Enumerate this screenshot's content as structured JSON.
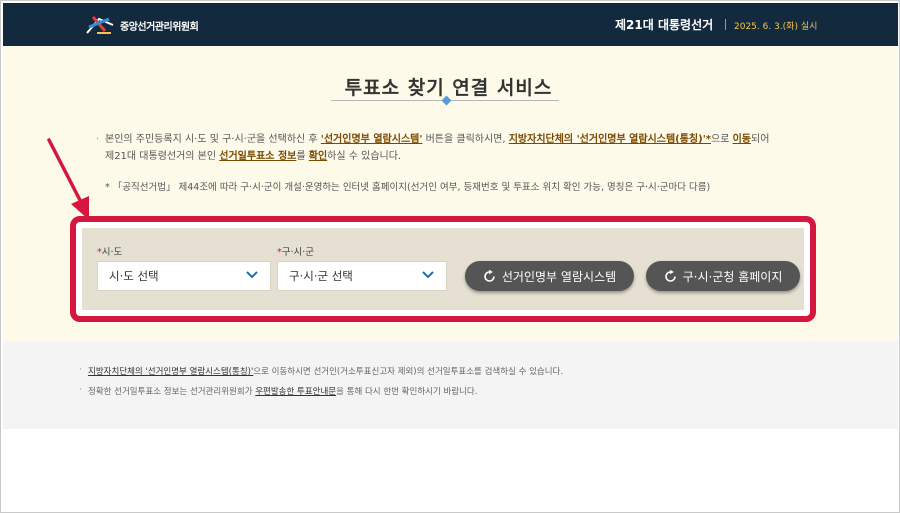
{
  "header": {
    "org_name": "중앙선거관리위원회",
    "election_title": "제21대 대통령선거",
    "election_date": "2025. 6. 3.(화) 실시"
  },
  "page": {
    "title": "투표소 찾기 연결 서비스"
  },
  "description": {
    "p1": "본인의 주민등록지 시·도 및 구·시·군을 선택하신 후 ",
    "k1": "'선거인명부 열람시스템'",
    "p2": " 버튼을 클릭하시면, ",
    "k2": "지방자치단체의 '선거인명부 열람시스템(통칭)'*",
    "p3": "으로 ",
    "k3": "이동",
    "p4": "되어",
    "p5": "제21대 대통령선거의 본인 ",
    "k4": "선거일투표소 정보",
    "p6": "를 ",
    "k5": "확인",
    "p7": "하실 수 있습니다.",
    "note": "* 「공직선거법」 제44조에 따라 구·시·군이 개설·운영하는 인터넷 홈페이지(선거인 여부, 등재번호 및 투표소 위치 확인 가능, 명칭은 구·시·군마다 다름)"
  },
  "search": {
    "sido_label": "시·도",
    "sido_value": "시·도 선택",
    "sigungu_label": "구·시·군",
    "sigungu_value": "구·시·군 선택",
    "btn_registry": "선거인명부 열람시스템",
    "btn_homepage": "구·시·군청 홈페이지",
    "required_mark": "*"
  },
  "footer": {
    "l1_link": "지방자치단체의 '선거인명부 열람시스템(통칭)'",
    "l1_text": "으로 이동하시면 선거인(거소투표신고자 제외)의 선거일투표소를 검색하실 수 있습니다.",
    "l2_pre": "정확한 선거일투표소 정보는 선거관리위원회가 ",
    "l2_link": "우편발송한 투표안내문",
    "l2_post": "을 통해 다시 한번 확인하시기 바랍니다."
  },
  "colors": {
    "header_bg": "#13293d",
    "highlight_frame": "#d5163e",
    "button_bg": "#555555",
    "date_text": "#f4c64f"
  },
  "icons": [
    "election-logo-icon",
    "chevron-down-icon",
    "external-link-icon",
    "red-arrow-icon"
  ]
}
